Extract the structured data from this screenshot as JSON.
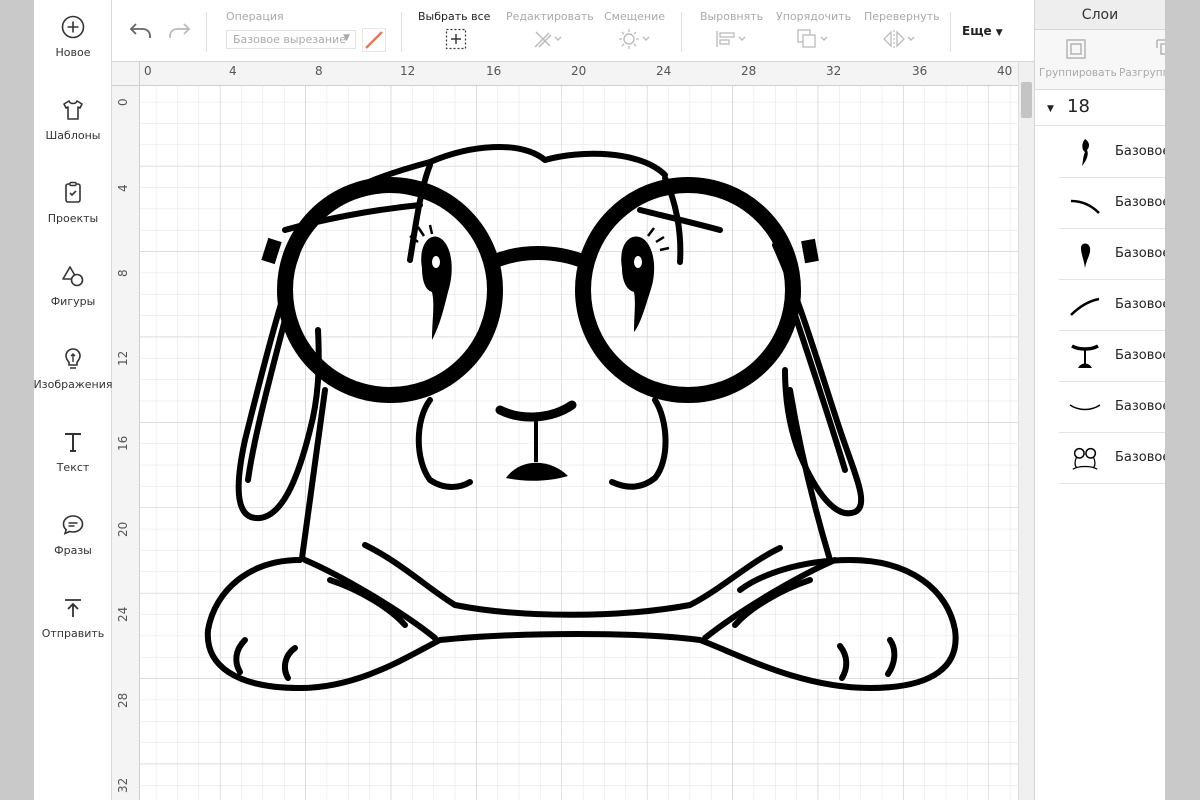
{
  "sidebar": {
    "items": [
      {
        "label": "Новое",
        "icon": "plus-circle-icon"
      },
      {
        "label": "Шаблоны",
        "icon": "tshirt-icon"
      },
      {
        "label": "Проекты",
        "icon": "projects-icon"
      },
      {
        "label": "Фигуры",
        "icon": "shapes-icon"
      },
      {
        "label": "Изображения",
        "icon": "lightbulb-icon"
      },
      {
        "label": "Текст",
        "icon": "text-icon"
      },
      {
        "label": "Фразы",
        "icon": "speech-bubble-icon"
      },
      {
        "label": "Отправить",
        "icon": "upload-icon"
      }
    ]
  },
  "toolbar": {
    "undo_icon": "undo-icon",
    "redo_icon": "redo-icon",
    "operation_label": "Операция",
    "operation_value": "Базовое вырезание",
    "select_all_label": "Выбрать все",
    "edit_label": "Редактировать",
    "offset_label": "Смещение",
    "align_label": "Выровнять",
    "arrange_label": "Упорядочить",
    "flip_label": "Перевернуть",
    "more_label": "Еще"
  },
  "rulers": {
    "horizontal": [
      "0",
      "4",
      "8",
      "12",
      "16",
      "20",
      "24",
      "28",
      "32",
      "36",
      "40"
    ],
    "vertical": [
      "0",
      "4",
      "8",
      "12",
      "16",
      "20",
      "24",
      "28",
      "32"
    ]
  },
  "layers": {
    "title": "Слои",
    "group_label": "Группировать",
    "ungroup_label": "Разгруппировать",
    "count": "18",
    "items": [
      {
        "name": "Базовое вырезание",
        "thumb": "ear-shape-thumb"
      },
      {
        "name": "Базовое вырезание",
        "thumb": "curve-thumb"
      },
      {
        "name": "Базовое вырезание",
        "thumb": "eye-shape-thumb"
      },
      {
        "name": "Базовое вырезание",
        "thumb": "curve-thumb"
      },
      {
        "name": "Базовое вырезание",
        "thumb": "nose-shape-thumb"
      },
      {
        "name": "Базовое вырезание",
        "thumb": "mouth-curve-thumb"
      },
      {
        "name": "Базовое вырезание",
        "thumb": "bunny-thumb"
      }
    ]
  },
  "colors": {
    "stroke": "#000000",
    "pen_swatch": "#e07b5a",
    "grid_minor": "#e3e3e3",
    "grid_major": "#c8c8c8"
  }
}
